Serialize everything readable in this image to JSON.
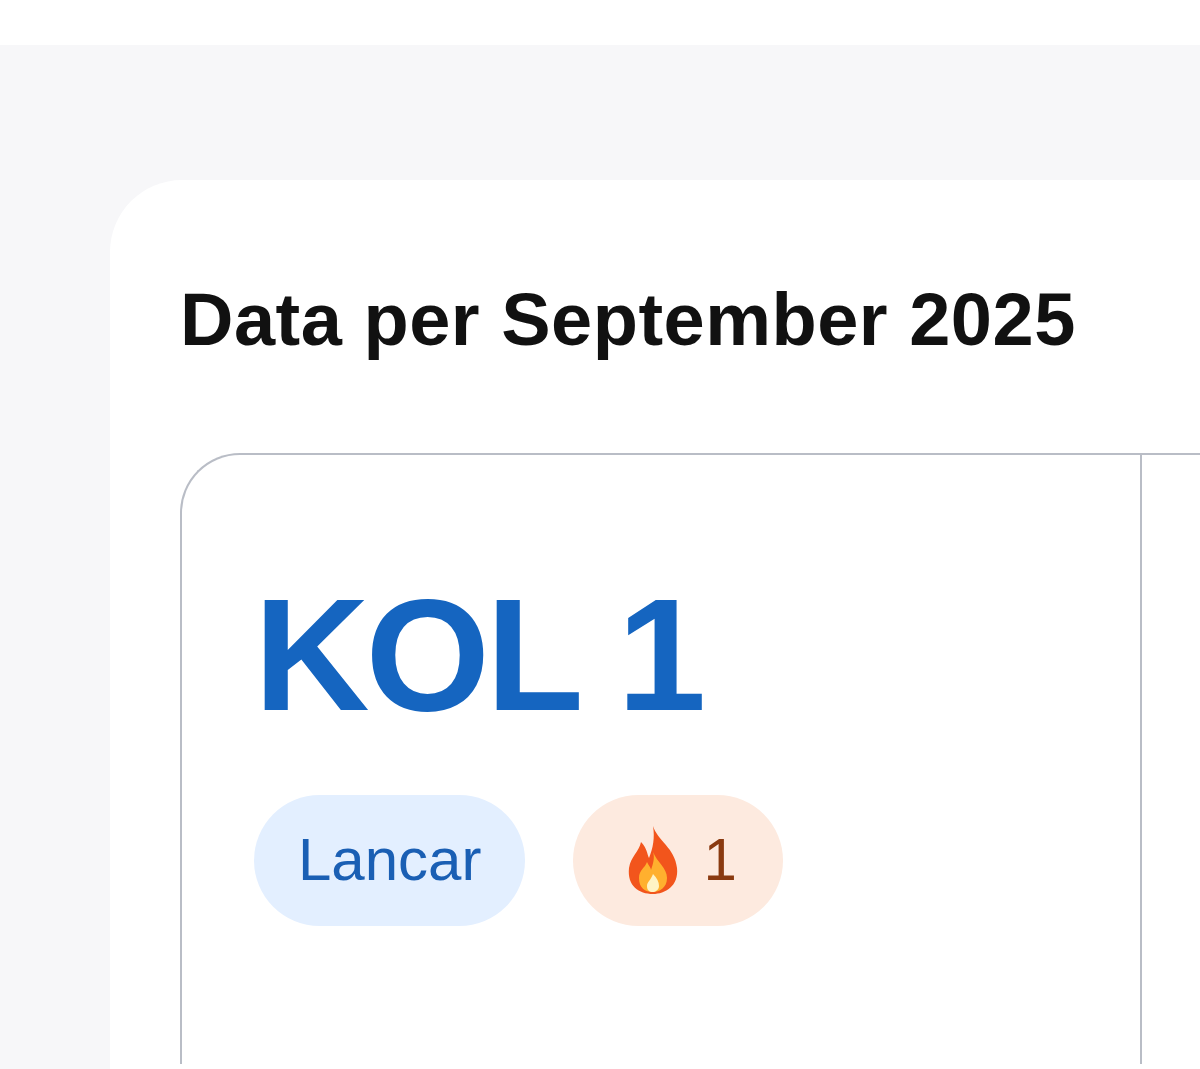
{
  "title": "Data per September 2025",
  "cards": [
    {
      "title": "KOL 1",
      "status": "Lancar",
      "streak": "1"
    },
    {
      "kind": "cut"
    }
  ]
}
